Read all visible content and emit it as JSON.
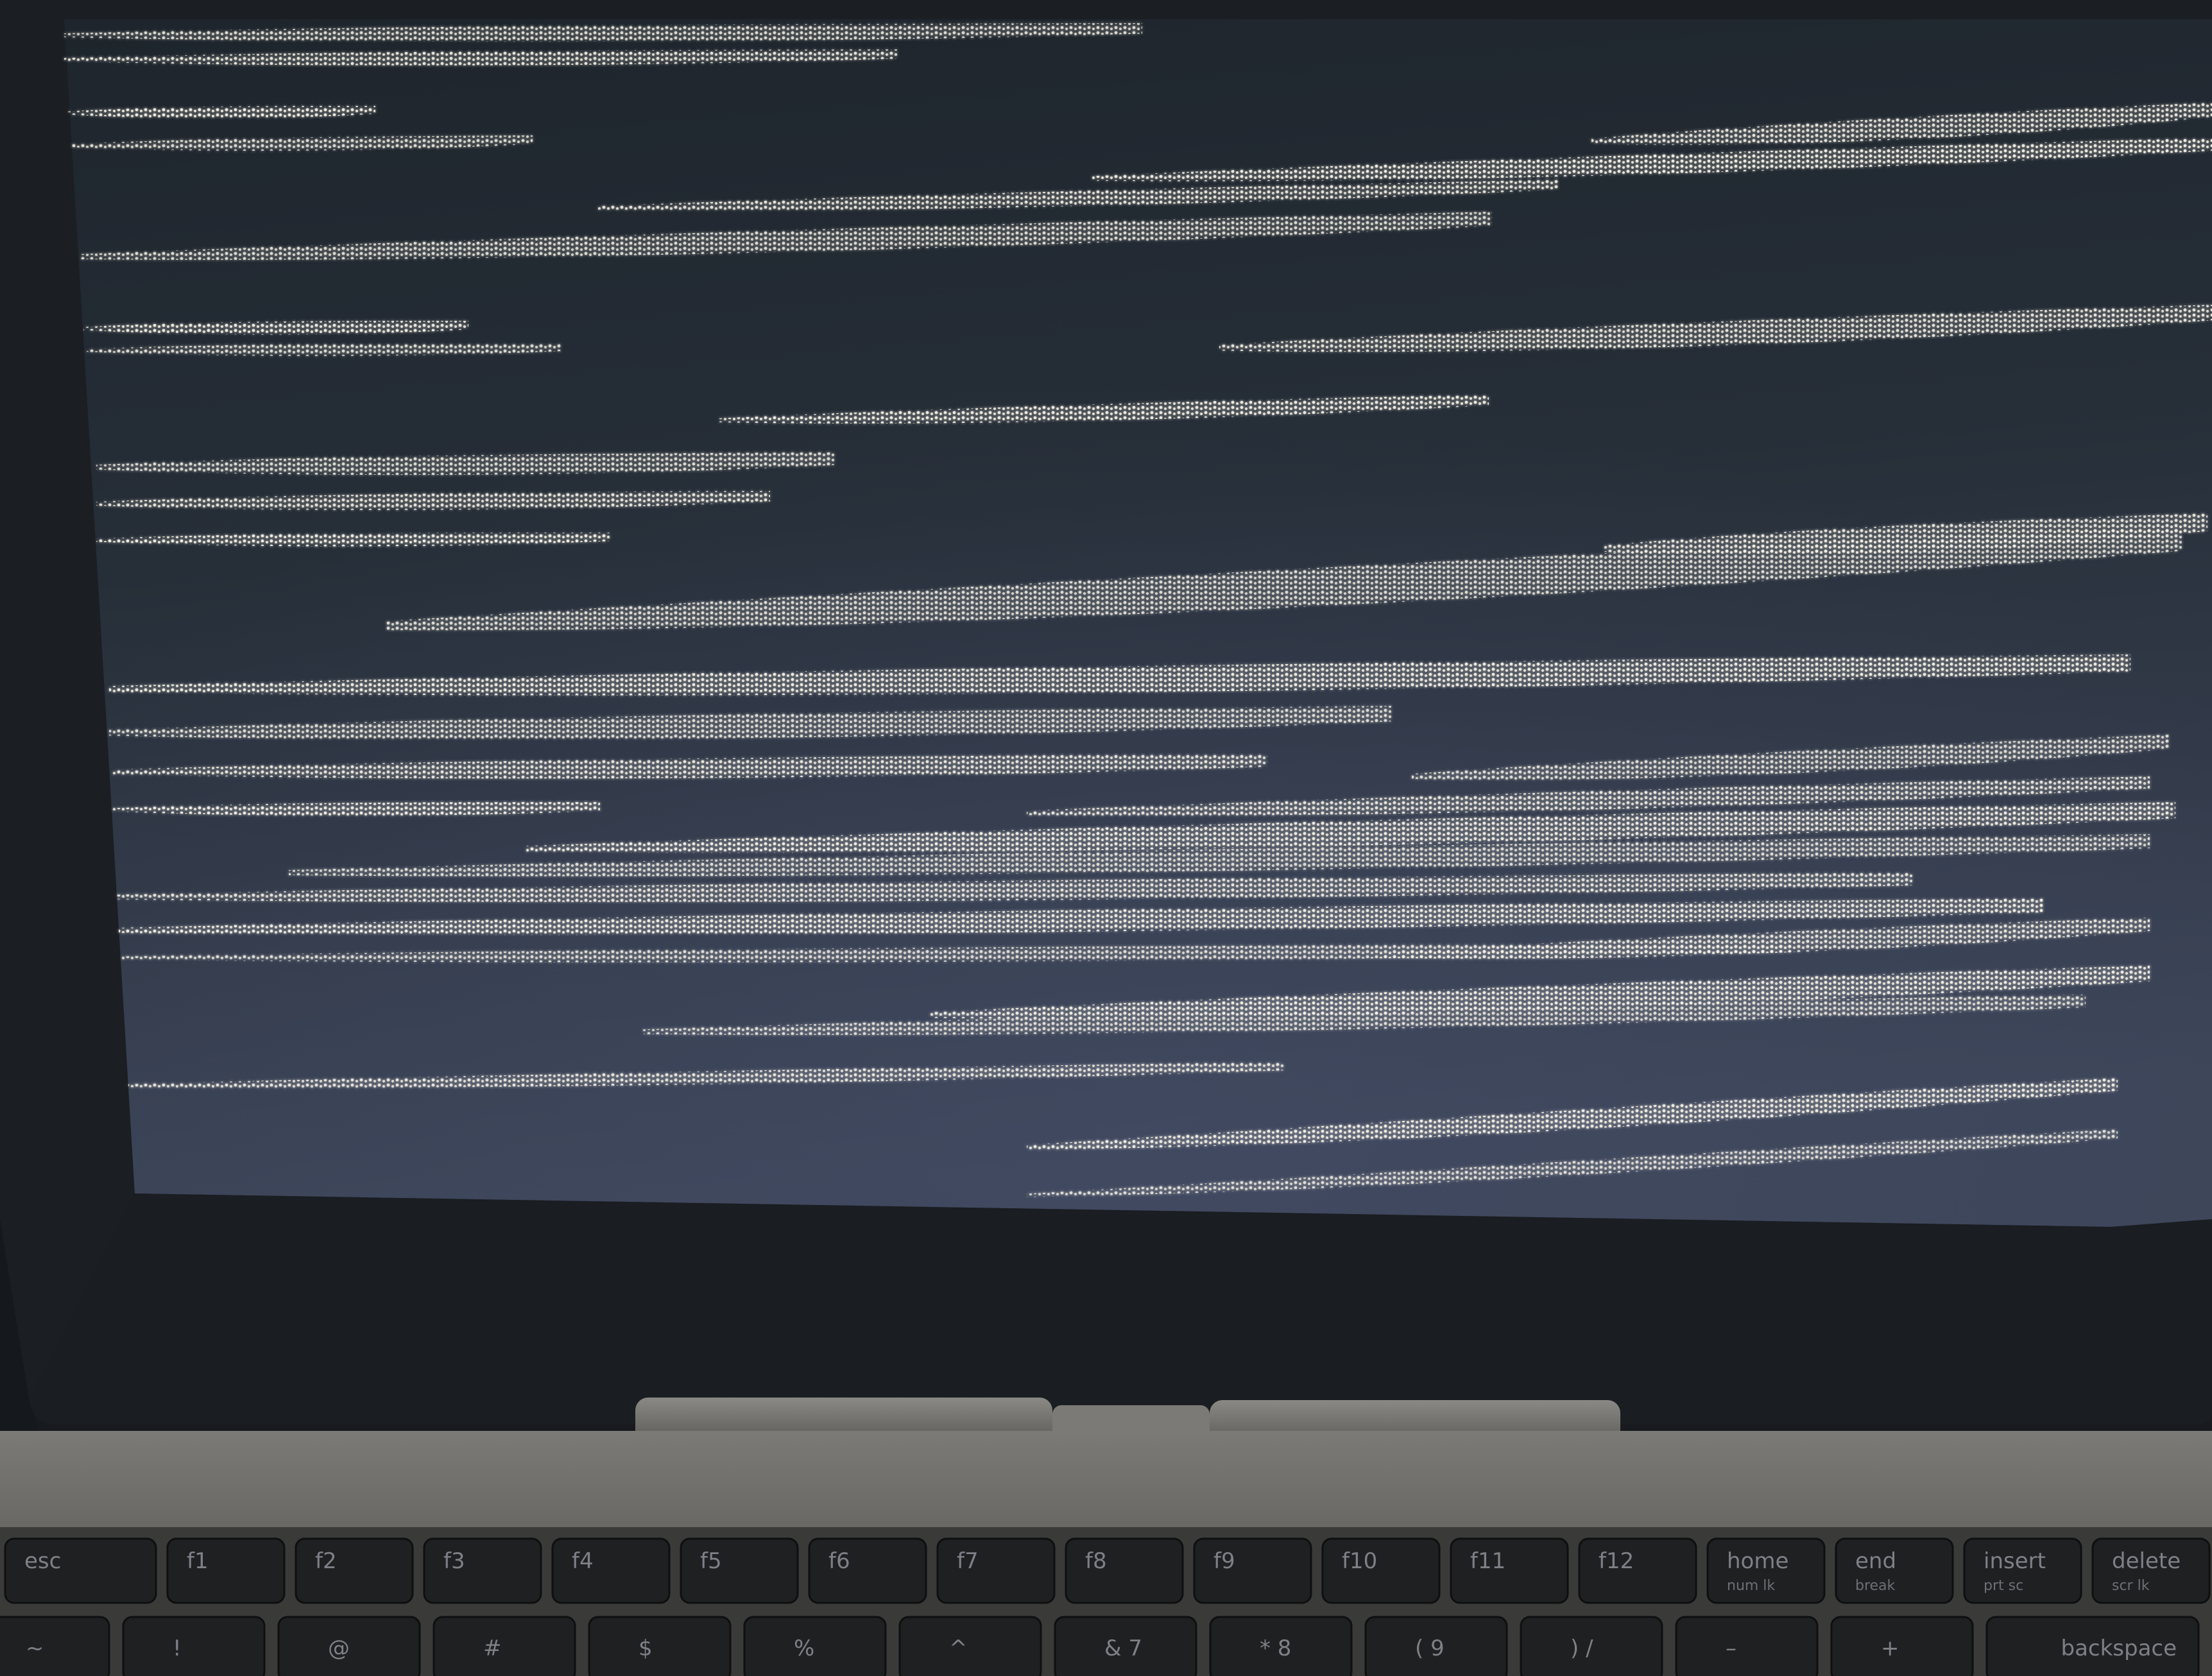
{
  "photo": {
    "subject": "laptop-screen-with-glitch-artifacts",
    "screen_colors": {
      "top": "#1f262d",
      "bottom": "#3c4457",
      "glitch": "#f2f0e6"
    }
  },
  "keyboard": {
    "function_row": [
      {
        "key": "esc",
        "label": "esc",
        "sub": ""
      },
      {
        "key": "f1",
        "label": "f1",
        "sub": ""
      },
      {
        "key": "f2",
        "label": "f2",
        "sub": ""
      },
      {
        "key": "f3",
        "label": "f3",
        "sub": ""
      },
      {
        "key": "f4",
        "label": "f4",
        "sub": ""
      },
      {
        "key": "f5",
        "label": "f5",
        "sub": ""
      },
      {
        "key": "f6",
        "label": "f6",
        "sub": ""
      },
      {
        "key": "f7",
        "label": "f7",
        "sub": ""
      },
      {
        "key": "f8",
        "label": "f8",
        "sub": ""
      },
      {
        "key": "f9",
        "label": "f9",
        "sub": ""
      },
      {
        "key": "f10",
        "label": "f10",
        "sub": ""
      },
      {
        "key": "f11",
        "label": "f11",
        "sub": ""
      },
      {
        "key": "f12",
        "label": "f12",
        "sub": ""
      },
      {
        "key": "home",
        "label": "home",
        "sub": "num lk"
      },
      {
        "key": "end",
        "label": "end",
        "sub": "break"
      },
      {
        "key": "insert",
        "label": "insert",
        "sub": "prt sc"
      },
      {
        "key": "delete",
        "label": "delete",
        "sub": "scr lk"
      }
    ],
    "number_row": [
      {
        "key": "tilde",
        "label": "~"
      },
      {
        "key": "exclam",
        "label": "!"
      },
      {
        "key": "at",
        "label": "@"
      },
      {
        "key": "hash",
        "label": "#"
      },
      {
        "key": "dollar",
        "label": "$"
      },
      {
        "key": "percent",
        "label": "%"
      },
      {
        "key": "caret",
        "label": "^"
      },
      {
        "key": "ampersand",
        "label": "& 7"
      },
      {
        "key": "asterisk",
        "label": "* 8"
      },
      {
        "key": "lparen",
        "label": "( 9"
      },
      {
        "key": "rparen",
        "label": ") /"
      },
      {
        "key": "minus",
        "label": "–"
      },
      {
        "key": "plus",
        "label": "+"
      },
      {
        "key": "backspace",
        "label": "backspace"
      }
    ]
  }
}
